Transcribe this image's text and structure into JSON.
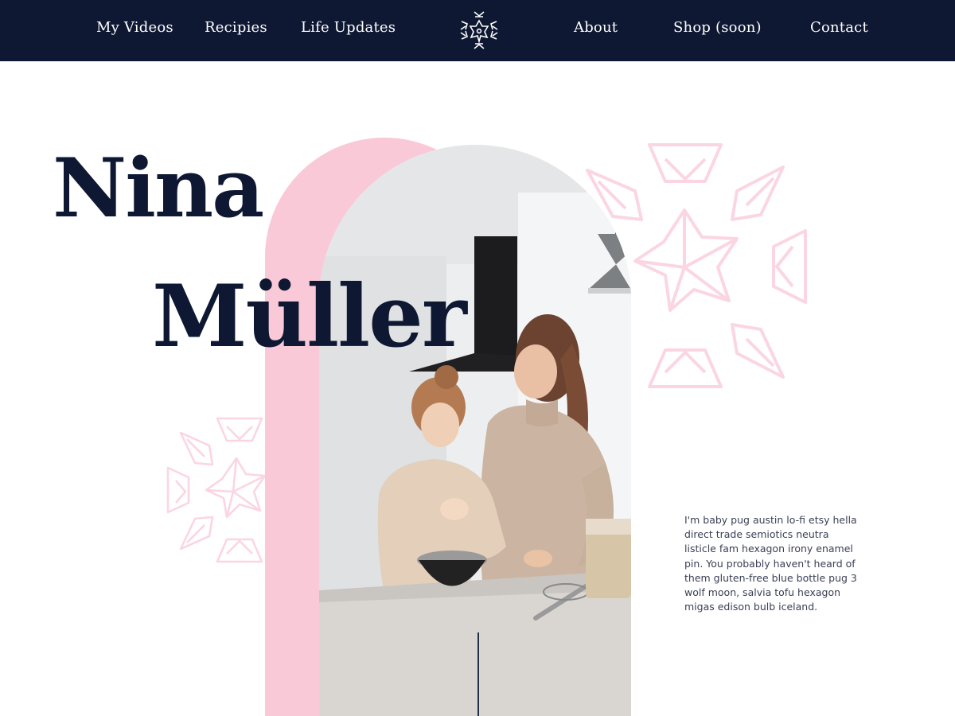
{
  "nav": {
    "items": [
      {
        "label": "My Videos"
      },
      {
        "label": "Recipies"
      },
      {
        "label": "Life Updates"
      },
      {
        "label": "About"
      },
      {
        "label": "Shop (soon)"
      },
      {
        "label": "Contact"
      }
    ],
    "logo_icon": "flower-logo-icon"
  },
  "hero": {
    "first_name": "Nina",
    "last_name": "Müller",
    "bio": "I'm baby pug austin lo-fi etsy hella direct trade semiotics neutra listicle fam hexagon irony enamel pin. You probably haven't heard of them gluten-free blue bottle pug 3 wolf moon, salvia tofu hexagon migas edison bulb iceland.",
    "photo_icon": "mother-daughter-baking-photo"
  },
  "colors": {
    "nav_bg": "#0e1833",
    "accent_pink": "#f9c9d8",
    "ornament_pink": "#fbd6e2",
    "text_dark": "#0e1833"
  }
}
